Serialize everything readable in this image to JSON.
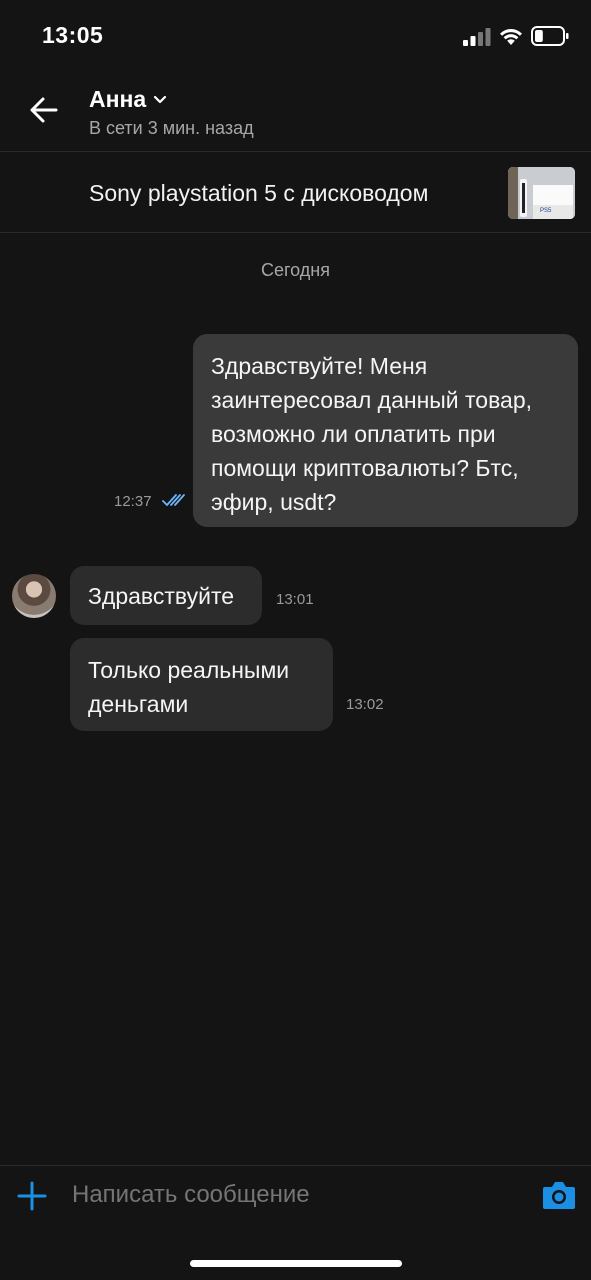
{
  "status_bar": {
    "time": "13:05",
    "battery_level": 0.3
  },
  "header": {
    "contact_name": "Анна",
    "contact_status": "В сети 3 мин. назад"
  },
  "product": {
    "title": "Sony playstation 5 с дисководом"
  },
  "date_separator": "Сегодня",
  "messages": [
    {
      "direction": "outgoing",
      "lines": [
        "Здравствуйте! Меня",
        "заинтересовал данный товар,",
        "возможно ли оплатить при",
        "помощи криптовалюты? Бтс,",
        "эфир, usdt?"
      ],
      "time": "12:37",
      "status": "read"
    },
    {
      "direction": "incoming",
      "lines": [
        "Здравствуйте"
      ],
      "time": "13:01"
    },
    {
      "direction": "incoming",
      "lines": [
        "Только реальными",
        "деньгами"
      ],
      "time": "13:02"
    }
  ],
  "composer": {
    "placeholder": "Написать сообщение"
  },
  "icons": {
    "back": "arrow-left-icon",
    "dropdown": "chevron-down-icon",
    "attach": "plus-icon",
    "camera": "camera-icon",
    "read_receipt": "double-check-icon"
  },
  "colors": {
    "background": "#141414",
    "outgoing_bubble": "#3a3a3a",
    "incoming_bubble": "#2c2c2c",
    "accent": "#1a8fe3",
    "read_check": "#6cb6ff"
  }
}
